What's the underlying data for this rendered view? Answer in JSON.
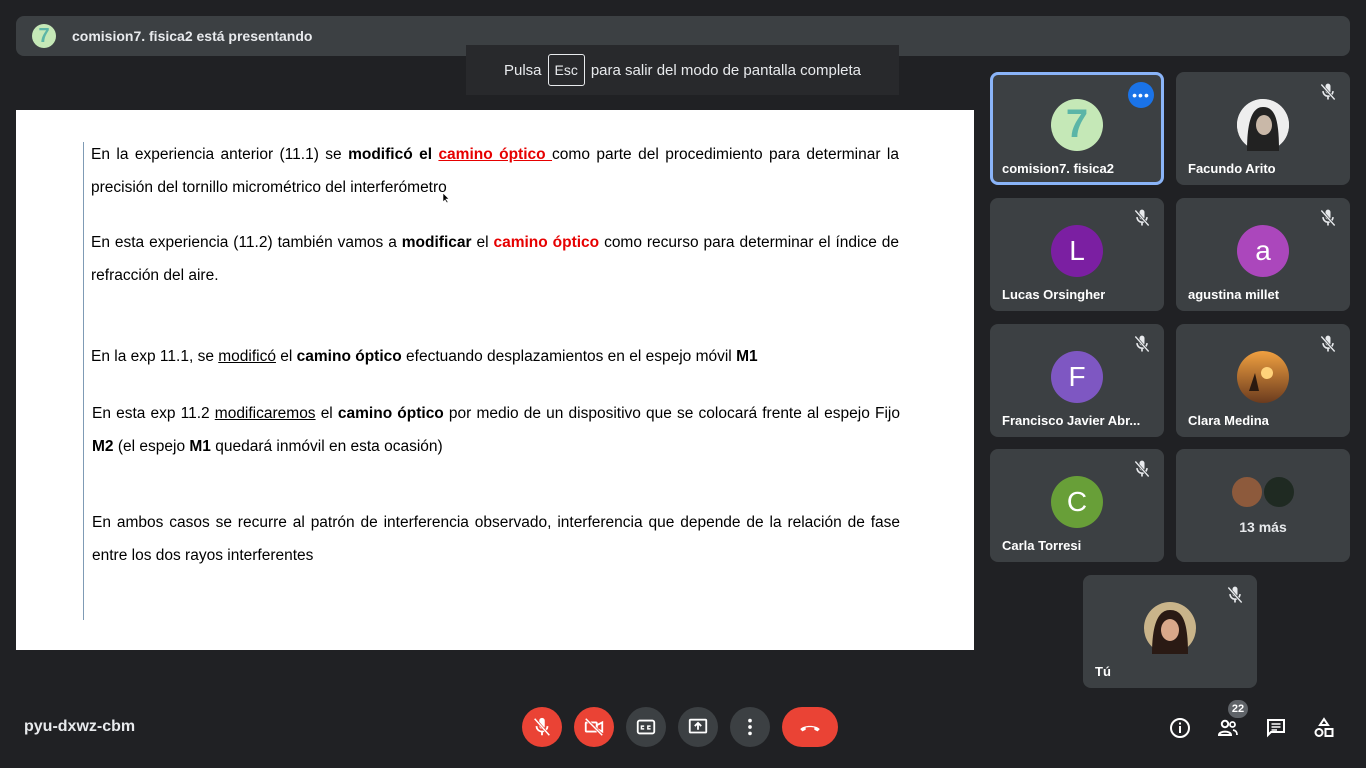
{
  "presenting_bar": {
    "text": "comision7. fisica2 está presentando",
    "avatar_letter": "7"
  },
  "fullscreen_toast": {
    "before": "Pulsa",
    "key": "Esc",
    "after": "para salir del modo de pantalla completa"
  },
  "slide": {
    "p1": {
      "a": "En la experiencia anterior (11.1)  se ",
      "b": "modificó el",
      "c": " ",
      "d": "camino óptico ",
      "e": "como parte del procedimiento para determinar la precisión del tornillo micrométrico del interferómetro"
    },
    "p2": {
      "a": "En esta experiencia (11.2) también vamos a ",
      "b": "modificar",
      "c": "  el ",
      "d": "camino óptico",
      "e": " como recurso para determinar el índice de refracción del aire."
    },
    "p3": {
      "a": "En la exp 11.1, se ",
      "b": "modificó",
      "c": " el ",
      "d": "camino óptico",
      "e": " efectuando desplazamientos en el espejo móvil  ",
      "f": "M1"
    },
    "p4": {
      "a": "En esta exp 11.2  ",
      "b": "modificaremos",
      "c": " el ",
      "d": "camino óptico",
      "e": " por medio de un dispositivo que se colocará frente al espejo Fijo ",
      "f": "M2",
      "g": "  (el espejo ",
      "h": "M1",
      "i": "  quedará inmóvil en esta ocasión)"
    },
    "p5": "En ambos casos se recurre al patrón de interferencia observado, interferencia que depende de la relación de fase entre los dos rayos interferentes"
  },
  "participants": [
    {
      "name": "comision7. fisica2",
      "initial": "7",
      "color": "#c5e8b7"
    },
    {
      "name": "Facundo Arito",
      "initial": "",
      "color": "#e0e0e0"
    },
    {
      "name": "Lucas Orsingher",
      "initial": "L",
      "color": "#7b1fa2"
    },
    {
      "name": "agustina millet",
      "initial": "a",
      "color": "#ab47bc"
    },
    {
      "name": "Francisco Javier Abr...",
      "initial": "F",
      "color": "#7e57c2"
    },
    {
      "name": "Clara Medina",
      "initial": "",
      "color": "#d98a3b"
    },
    {
      "name": "Carla Torresi",
      "initial": "C",
      "color": "#689f38"
    },
    {
      "name": "13 más",
      "initial": "",
      "color": "#5f6368"
    },
    {
      "name": "Tú",
      "initial": "",
      "color": "#9e8a6a"
    }
  ],
  "bottom": {
    "meeting_code": "pyu-dxwz-cbm",
    "people_count": "22"
  },
  "colors": {
    "background": "#202124",
    "tile": "#3c4043",
    "danger": "#ea4335",
    "accent": "#8ab4f8",
    "menu": "#1a73e8"
  },
  "icons": [
    "mic-off-icon",
    "camera-off-icon",
    "captions-icon",
    "present-screen-icon",
    "more-options-icon",
    "hang-up-icon",
    "info-icon",
    "people-icon",
    "chat-icon",
    "activities-icon"
  ]
}
